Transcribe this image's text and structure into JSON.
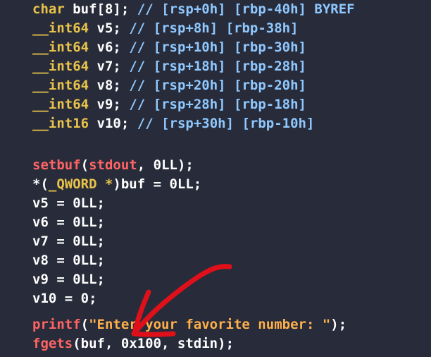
{
  "code": {
    "decl_buf": {
      "type": "char",
      "name": "buf[8]",
      "semi": ";",
      "comment": " // [rsp+0h] [rbp-40h] BYREF"
    },
    "decl_v5": {
      "type": "__int64",
      "name": "v5",
      "semi": ";",
      "comment": " // [rsp+8h] [rbp-38h]"
    },
    "decl_v6": {
      "type": "__int64",
      "name": "v6",
      "semi": ";",
      "comment": " // [rsp+10h] [rbp-30h]"
    },
    "decl_v7": {
      "type": "__int64",
      "name": "v7",
      "semi": ";",
      "comment": " // [rsp+18h] [rbp-28h]"
    },
    "decl_v8": {
      "type": "__int64",
      "name": "v8",
      "semi": ";",
      "comment": " // [rsp+20h] [rbp-20h]"
    },
    "decl_v9": {
      "type": "__int64",
      "name": "v9",
      "semi": ";",
      "comment": " // [rsp+28h] [rbp-18h]"
    },
    "decl_v10": {
      "type": "__int16",
      "name": "v10",
      "semi": ";",
      "comment": " // [rsp+30h] [rbp-10h]"
    },
    "setbuf": {
      "fn": "setbuf",
      "open": "(",
      "arg1": "stdout",
      "sep": ", ",
      "arg2": "0LL",
      "close": ");"
    },
    "qword_assign": {
      "prefix": "*(",
      "type": "_QWORD *",
      "rest": ")buf = 0LL;"
    },
    "assign_v5": "v5 = 0LL;",
    "assign_v6": "v6 = 0LL;",
    "assign_v7": "v7 = 0LL;",
    "assign_v8": "v8 = 0LL;",
    "assign_v9": "v9 = 0LL;",
    "assign_v10": "v10 = 0;",
    "printf": {
      "fn": "printf",
      "open": "(",
      "str": "\"Enter your favorite number: \"",
      "close": ");"
    },
    "fgets": {
      "fn": "fgets",
      "open": "(",
      "args": "buf, 0x100, stdin",
      "close": ");"
    }
  },
  "colors": {
    "background": "#282c3a",
    "type_keyword": "#e8c24a",
    "function": "#ff6464",
    "comment": "#8fc8ff",
    "string": "#ffb04a",
    "annotation_arrow": "#e0101a"
  },
  "annotation": {
    "icon": "red-hand-drawn-arrow-icon"
  }
}
